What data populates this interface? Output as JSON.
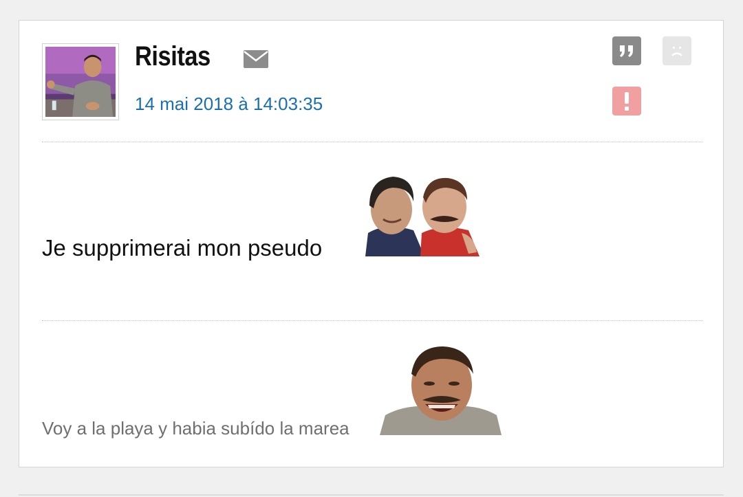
{
  "post": {
    "author": "Risitas",
    "date": "14 mai 2018 à 14:03:35",
    "message": "Je supprimerai mon pseudo",
    "signature": "Voy a la playa y habia subído la marea"
  },
  "actions": {
    "quote_icon": "quote-icon",
    "sad_icon": "sad-face-icon",
    "alert_icon": "alert-icon",
    "mail_icon": "mail-icon"
  },
  "colors": {
    "date_link": "#1a6fb0",
    "quote_button": "#8a8a8a",
    "sad_button": "#e6e6e6",
    "alert_button": "#f0a0a0"
  }
}
